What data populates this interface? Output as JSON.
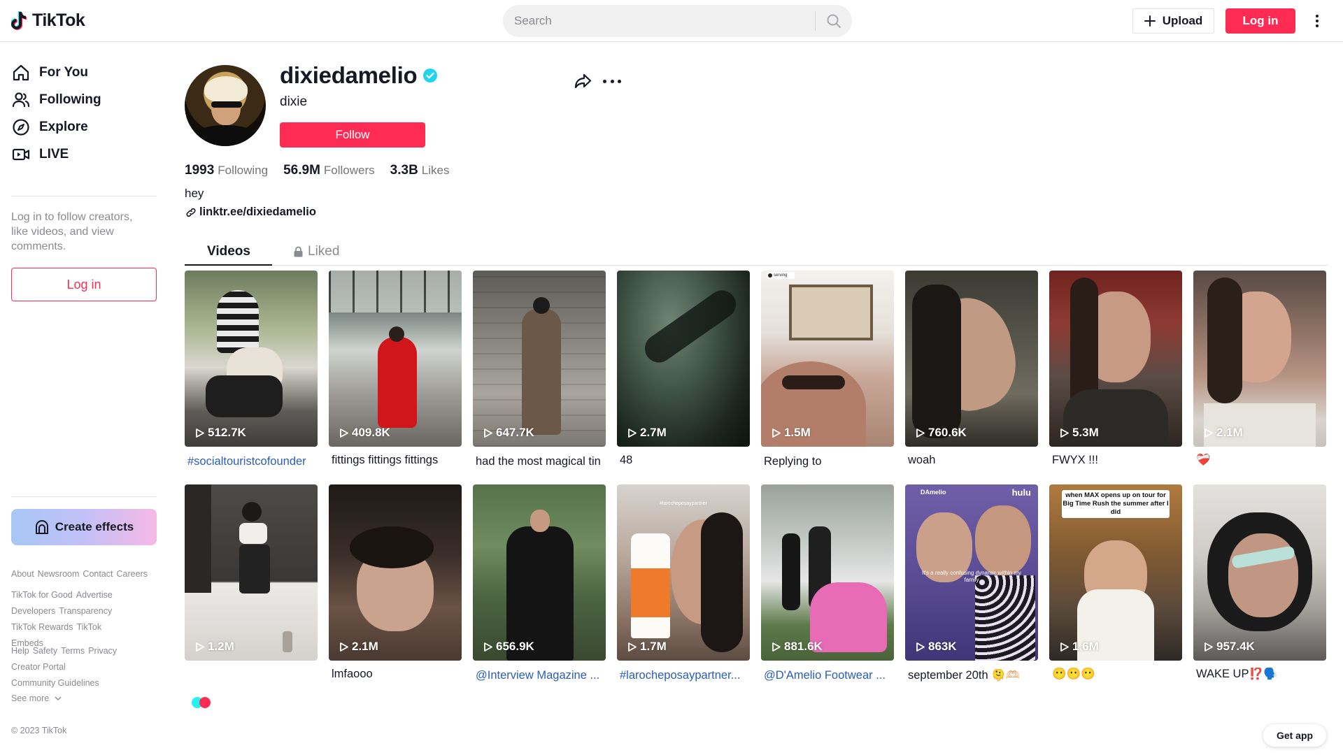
{
  "header": {
    "logo_text": "TikTok",
    "search_placeholder": "Search",
    "upload_label": "Upload",
    "login_label": "Log in"
  },
  "sidebar": {
    "nav": [
      {
        "label": "For You",
        "icon": "home-icon"
      },
      {
        "label": "Following",
        "icon": "users-icon"
      },
      {
        "label": "Explore",
        "icon": "compass-icon"
      },
      {
        "label": "LIVE",
        "icon": "live-icon"
      }
    ],
    "login_hint": "Log in to follow creators, like videos, and view comments.",
    "login_label": "Log in",
    "effects_label": "Create effects",
    "footer_groups": [
      [
        "About",
        "Newsroom",
        "Contact",
        "Careers"
      ],
      [
        "TikTok for Good",
        "Advertise",
        "Developers",
        "Transparency",
        "TikTok Rewards",
        "TikTok Embeds"
      ],
      [
        "Help",
        "Safety",
        "Terms",
        "Privacy",
        "Creator Portal",
        "Community Guidelines"
      ]
    ],
    "see_more": "See more",
    "copyright": "© 2023 TikTok"
  },
  "profile": {
    "username": "dixiedamelio",
    "nickname": "dixie",
    "follow_label": "Follow",
    "stats": [
      {
        "value": "1993",
        "label": "Following"
      },
      {
        "value": "56.9M",
        "label": "Followers"
      },
      {
        "value": "3.3B",
        "label": "Likes"
      }
    ],
    "bio": "hey",
    "link": "linktr.ee/dixiedamelio"
  },
  "tabs": {
    "videos": "Videos",
    "liked": "Liked"
  },
  "videos": [
    {
      "views": "512.7K",
      "caption": "#socialtouristcofounder",
      "tag": true
    },
    {
      "views": "409.8K",
      "caption": "fittings fittings fittings",
      "tag": false
    },
    {
      "views": "647.7K",
      "caption": "had the most magical tin",
      "tag": false
    },
    {
      "views": "2.7M",
      "caption": "48",
      "tag": false
    },
    {
      "views": "1.5M",
      "caption": "Replying to",
      "tag": false
    },
    {
      "views": "760.6K",
      "caption": "woah",
      "tag": false
    },
    {
      "views": "5.3M",
      "caption": "FWYX !!!",
      "tag": false
    },
    {
      "views": "2.1M",
      "caption": "❤️‍🩹",
      "tag": false
    },
    {
      "views": "1.2M",
      "caption": "",
      "tag": false
    },
    {
      "views": "2.1M",
      "caption": "lmfaooo",
      "tag": false
    },
    {
      "views": "656.9K",
      "caption": "@Interview Magazine ...",
      "tag": true
    },
    {
      "views": "1.7M",
      "caption": "#larocheposaypartner...",
      "tag": true
    },
    {
      "views": "881.6K",
      "caption": "@D'Amelio Footwear ...",
      "tag": true
    },
    {
      "views": "863K",
      "caption": "september 20th 🫠🫶🏻",
      "tag": false
    },
    {
      "views": "1.6M",
      "caption": "😶😶😶",
      "tag": false
    },
    {
      "views": "957.4K",
      "caption": "WAKE UP⁉️🗣️",
      "tag": false
    }
  ],
  "overlay_texts": {
    "t5_badge": "serving",
    "t12_tag": "#larocheposaypartner",
    "t14_brand": "DAmelio",
    "t14_hulu": "hulu",
    "t14_sub": "It's a really confusing dynamic within my family",
    "t15_banner": "when MAX opens up on tour for Big Time Rush the summer after I did"
  },
  "get_app": "Get app",
  "colors": {
    "brand": "#fe2c55",
    "verified": "#20d5ec",
    "tag_link": "#2b5db9"
  }
}
